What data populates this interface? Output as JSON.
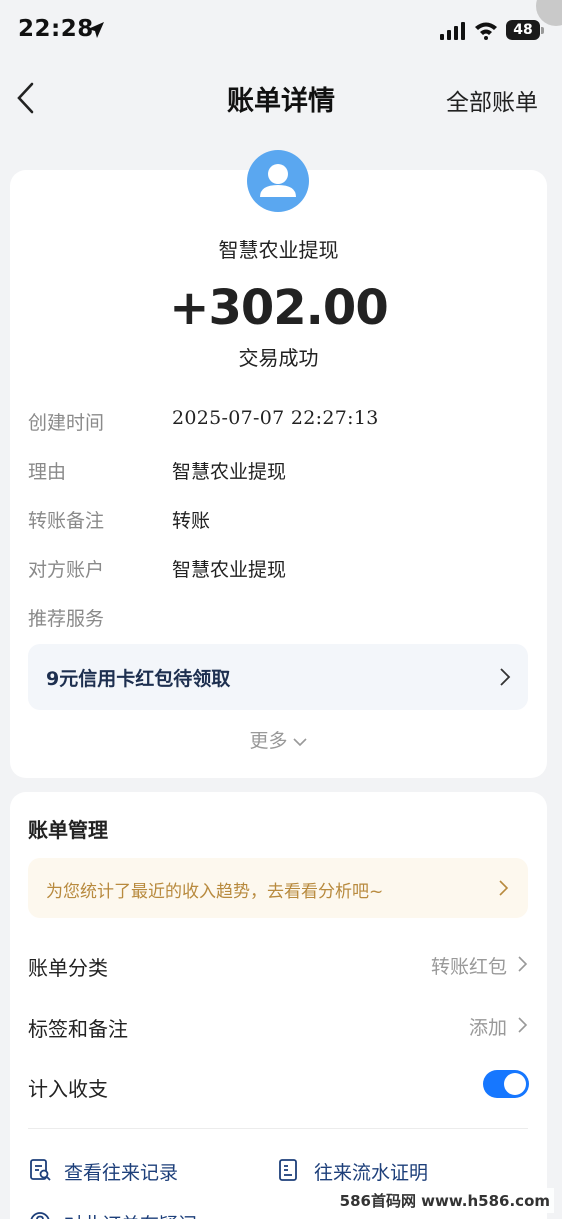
{
  "status_bar": {
    "time": "22:28",
    "battery": "48"
  },
  "nav": {
    "title": "账单详情",
    "right_label": "全部账单"
  },
  "bill": {
    "merchant": "智慧农业提现",
    "amount": "+302.00",
    "result": "交易成功",
    "rows": [
      {
        "label": "创建时间",
        "value": "2025-07-07 22:27:13"
      },
      {
        "label": "理由",
        "value": "智慧农业提现"
      },
      {
        "label": "转账备注",
        "value": "转账"
      },
      {
        "label": "对方账户",
        "value": "智慧农业提现"
      },
      {
        "label": "推荐服务",
        "value": ""
      }
    ],
    "promo": "9元信用卡红包待领取",
    "more": "更多"
  },
  "management": {
    "title": "账单管理",
    "tip": "为您统计了最近的收入趋势，去看看分析吧~",
    "items": [
      {
        "label": "账单分类",
        "value": "转账红包"
      },
      {
        "label": "标签和备注",
        "value": "添加"
      },
      {
        "label": "计入收支",
        "value": ""
      }
    ],
    "toggle_on": true,
    "links": [
      {
        "label": "查看往来记录"
      },
      {
        "label": "往来流水证明"
      },
      {
        "label": "对此订单有疑问"
      }
    ]
  },
  "watermark": "586首码网 www.h586.com",
  "colors": {
    "accent": "#1677ff",
    "avatar": "#5aa7f0",
    "tip_text": "#b88a3e",
    "link": "#1d3f7a"
  }
}
